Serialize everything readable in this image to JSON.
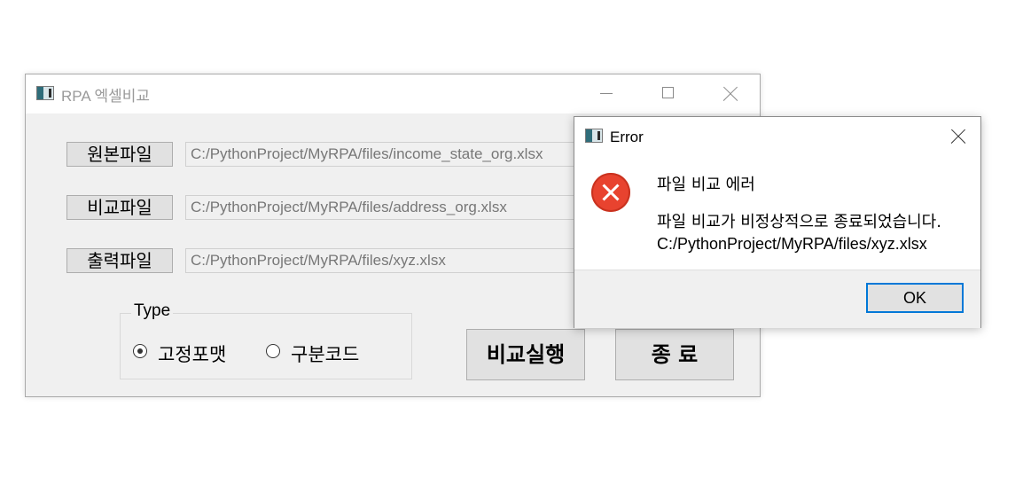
{
  "main_window": {
    "title": "RPA 엑셀비교",
    "title_icon": "app-window-icon",
    "controls": {
      "minimize_icon": "minimize-icon",
      "maximize_icon": "maximize-icon",
      "close_icon": "close-icon"
    },
    "source_file": {
      "button_label": "원본파일",
      "path": "C:/PythonProject/MyRPA/files/income_state_org.xlsx"
    },
    "compare_file": {
      "button_label": "비교파일",
      "path": "C:/PythonProject/MyRPA/files/address_org.xlsx"
    },
    "output_file": {
      "button_label": "출력파일",
      "path": "C:/PythonProject/MyRPA/files/xyz.xlsx"
    },
    "type_group": {
      "legend": "Type",
      "options": [
        {
          "label": "고정포맷",
          "checked": true
        },
        {
          "label": "구분코드",
          "checked": false
        }
      ]
    },
    "run_button_label": "비교실행",
    "exit_button_label": "종 료"
  },
  "error_dialog": {
    "title": "Error",
    "title_icon": "app-window-icon",
    "close_icon": "close-icon",
    "status_icon": "error-icon",
    "status_color": "#e8432f",
    "heading": "파일 비교 에러",
    "message_line1": "파일 비교가 비정상적으로 종료되었습니다.",
    "message_line2": "C:/PythonProject/MyRPA/files/xyz.xlsx",
    "ok_label": "OK",
    "accent_color": "#0078d7"
  }
}
